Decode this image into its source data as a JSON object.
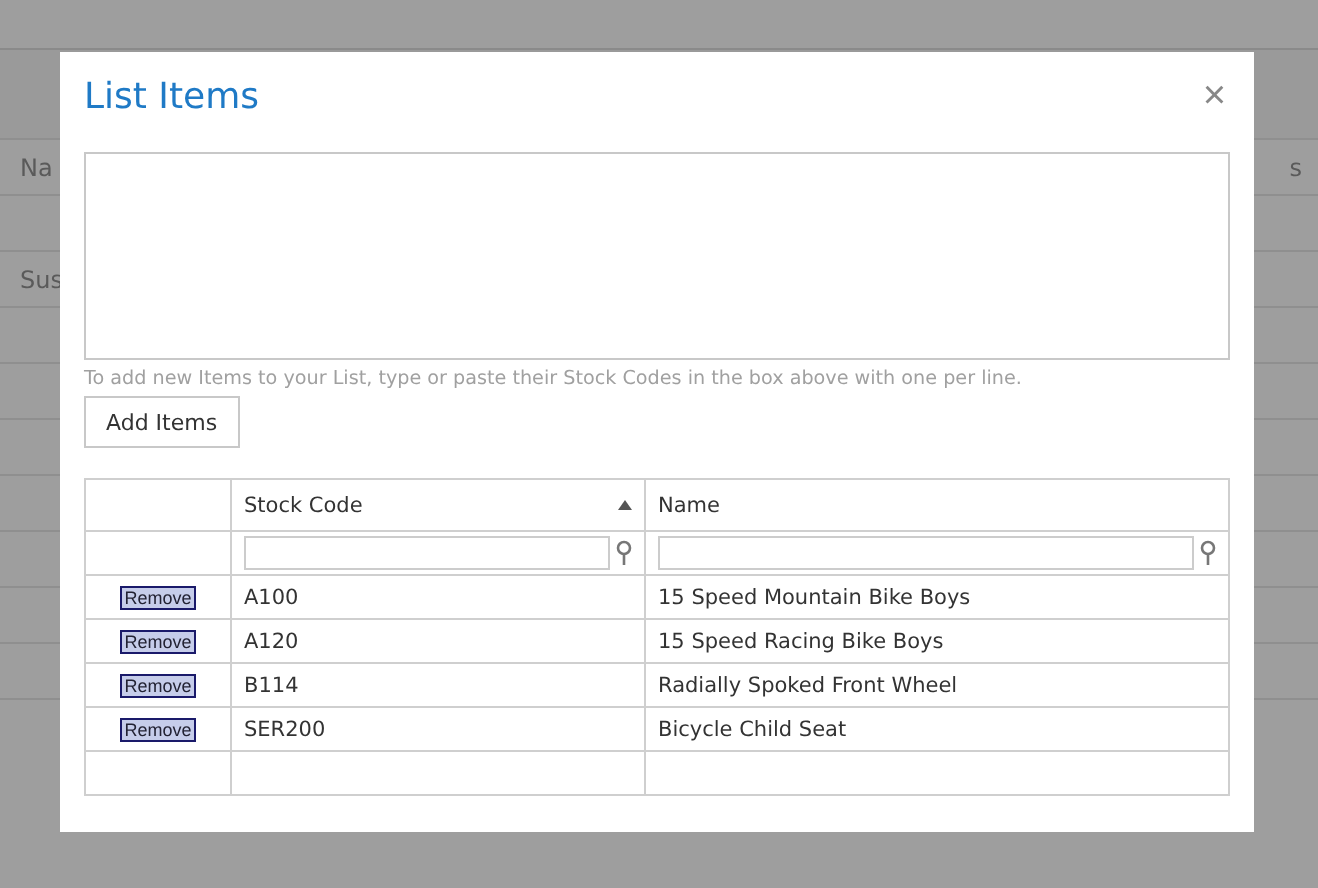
{
  "backdrop": {
    "header_left": "Na",
    "header_right": "s",
    "first_row": "Sus"
  },
  "dialog": {
    "title": "List Items",
    "close": "×",
    "hint": "To add new Items to your List, type or paste their Stock Codes in the box above with one per line.",
    "add_button": "Add Items",
    "table": {
      "columns": [
        {
          "label": "Stock Code",
          "sorted": true
        },
        {
          "label": "Name",
          "sorted": false
        }
      ],
      "rows": [
        {
          "action": "Remove",
          "code": "A100",
          "name": "15 Speed Mountain Bike Boys"
        },
        {
          "action": "Remove",
          "code": "A120",
          "name": "15 Speed Racing Bike Boys"
        },
        {
          "action": "Remove",
          "code": "B114",
          "name": "Radially Spoked Front Wheel"
        },
        {
          "action": "Remove",
          "code": "SER200",
          "name": "Bicycle Child Seat"
        }
      ]
    }
  }
}
